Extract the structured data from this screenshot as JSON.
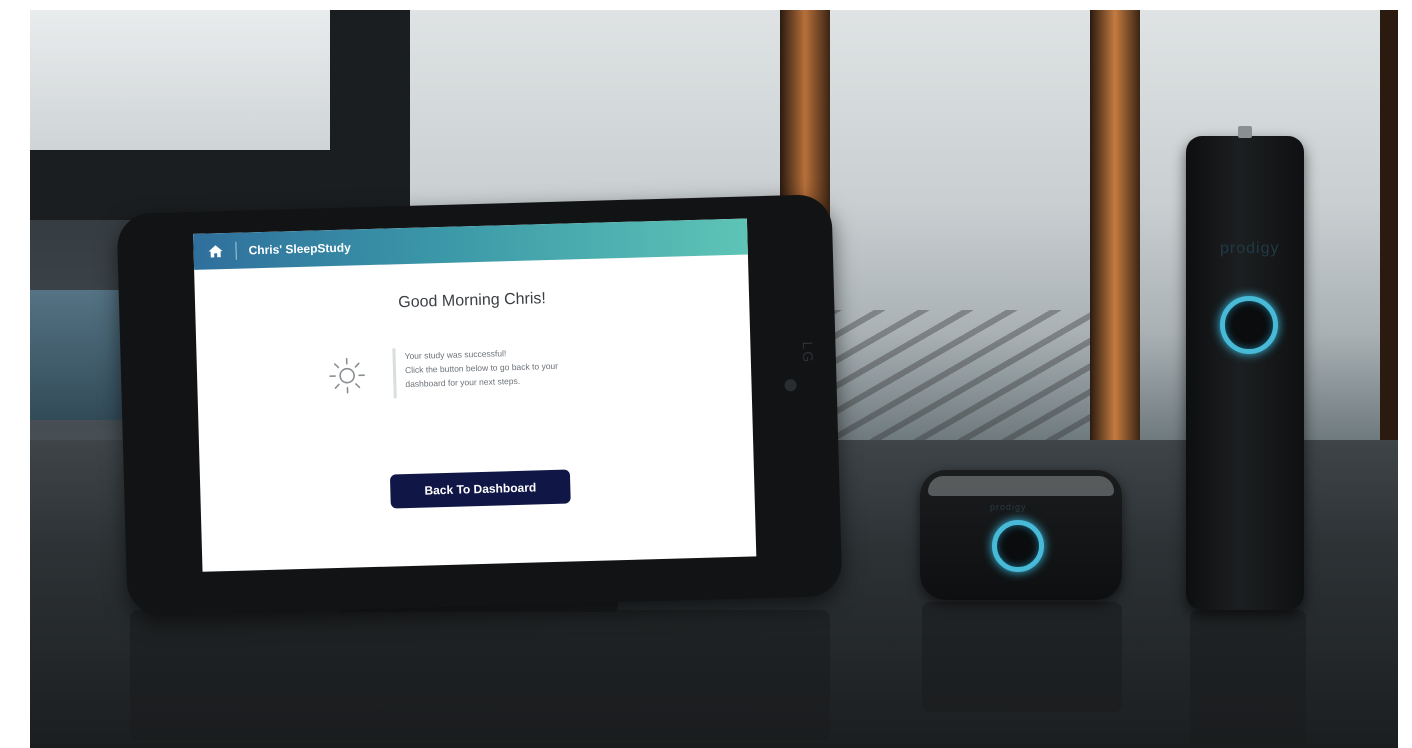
{
  "app": {
    "header_title": "Chris' SleepStudy",
    "greeting": "Good Morning Chris!",
    "status_line_1": "Your study was successful!",
    "status_line_2": "Click the button below to go back to your",
    "status_line_3": "dashboard for your next steps.",
    "cta_label": "Back To Dashboard",
    "colors": {
      "header_start": "#2f6f9d",
      "header_end": "#5ec4b6",
      "cta": "#101747"
    }
  },
  "icons": {
    "header": "home-icon",
    "status": "sun-icon"
  },
  "hardware": {
    "tablet_brand": "LG",
    "device_brand": "prodigy"
  }
}
